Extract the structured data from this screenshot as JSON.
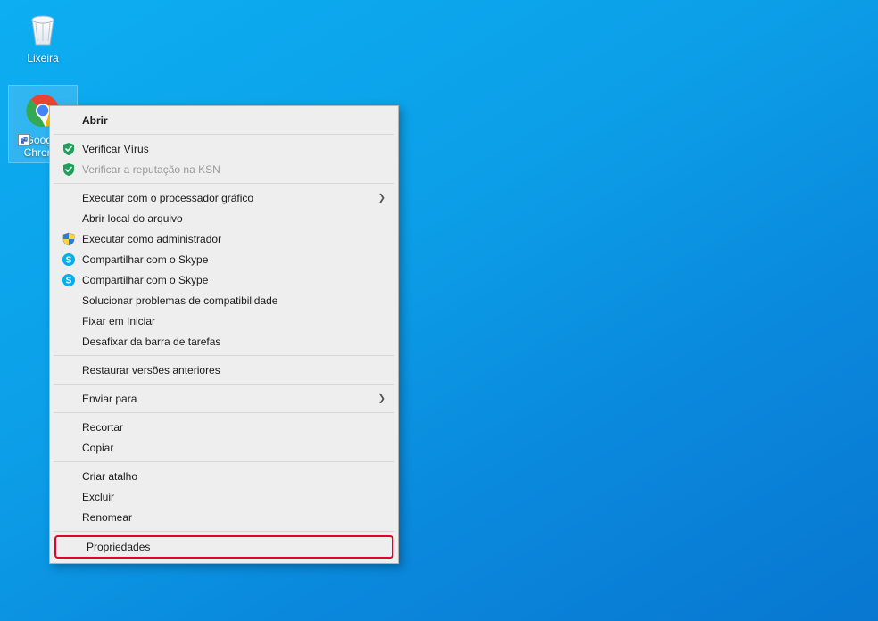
{
  "desktop": {
    "icons": [
      {
        "label": "Lixeira"
      },
      {
        "label": "Google Chrome"
      }
    ]
  },
  "context_menu": {
    "groups": [
      [
        {
          "label": "Abrir",
          "bold": true,
          "submenu": false,
          "icon": ""
        }
      ],
      [
        {
          "label": "Verificar Vírus",
          "icon": "shield-green"
        },
        {
          "label": "Verificar a reputação na KSN",
          "icon": "shield-green",
          "disabled": true
        }
      ],
      [
        {
          "label": "Executar com o processador gráfico",
          "submenu": true
        },
        {
          "label": "Abrir local do arquivo"
        },
        {
          "label": "Executar como administrador",
          "icon": "uac-shield"
        },
        {
          "label": "Compartilhar com o Skype",
          "icon": "skype"
        },
        {
          "label": "Compartilhar com o Skype",
          "icon": "skype"
        },
        {
          "label": "Solucionar problemas de compatibilidade"
        },
        {
          "label": "Fixar em Iniciar"
        },
        {
          "label": "Desafixar da barra de tarefas"
        }
      ],
      [
        {
          "label": "Restaurar versões anteriores"
        }
      ],
      [
        {
          "label": "Enviar para",
          "submenu": true
        }
      ],
      [
        {
          "label": "Recortar"
        },
        {
          "label": "Copiar"
        }
      ],
      [
        {
          "label": "Criar atalho"
        },
        {
          "label": "Excluir"
        },
        {
          "label": "Renomear"
        }
      ],
      [
        {
          "label": "Propriedades",
          "highlight": true
        }
      ]
    ],
    "arrow_glyph": "❯"
  }
}
